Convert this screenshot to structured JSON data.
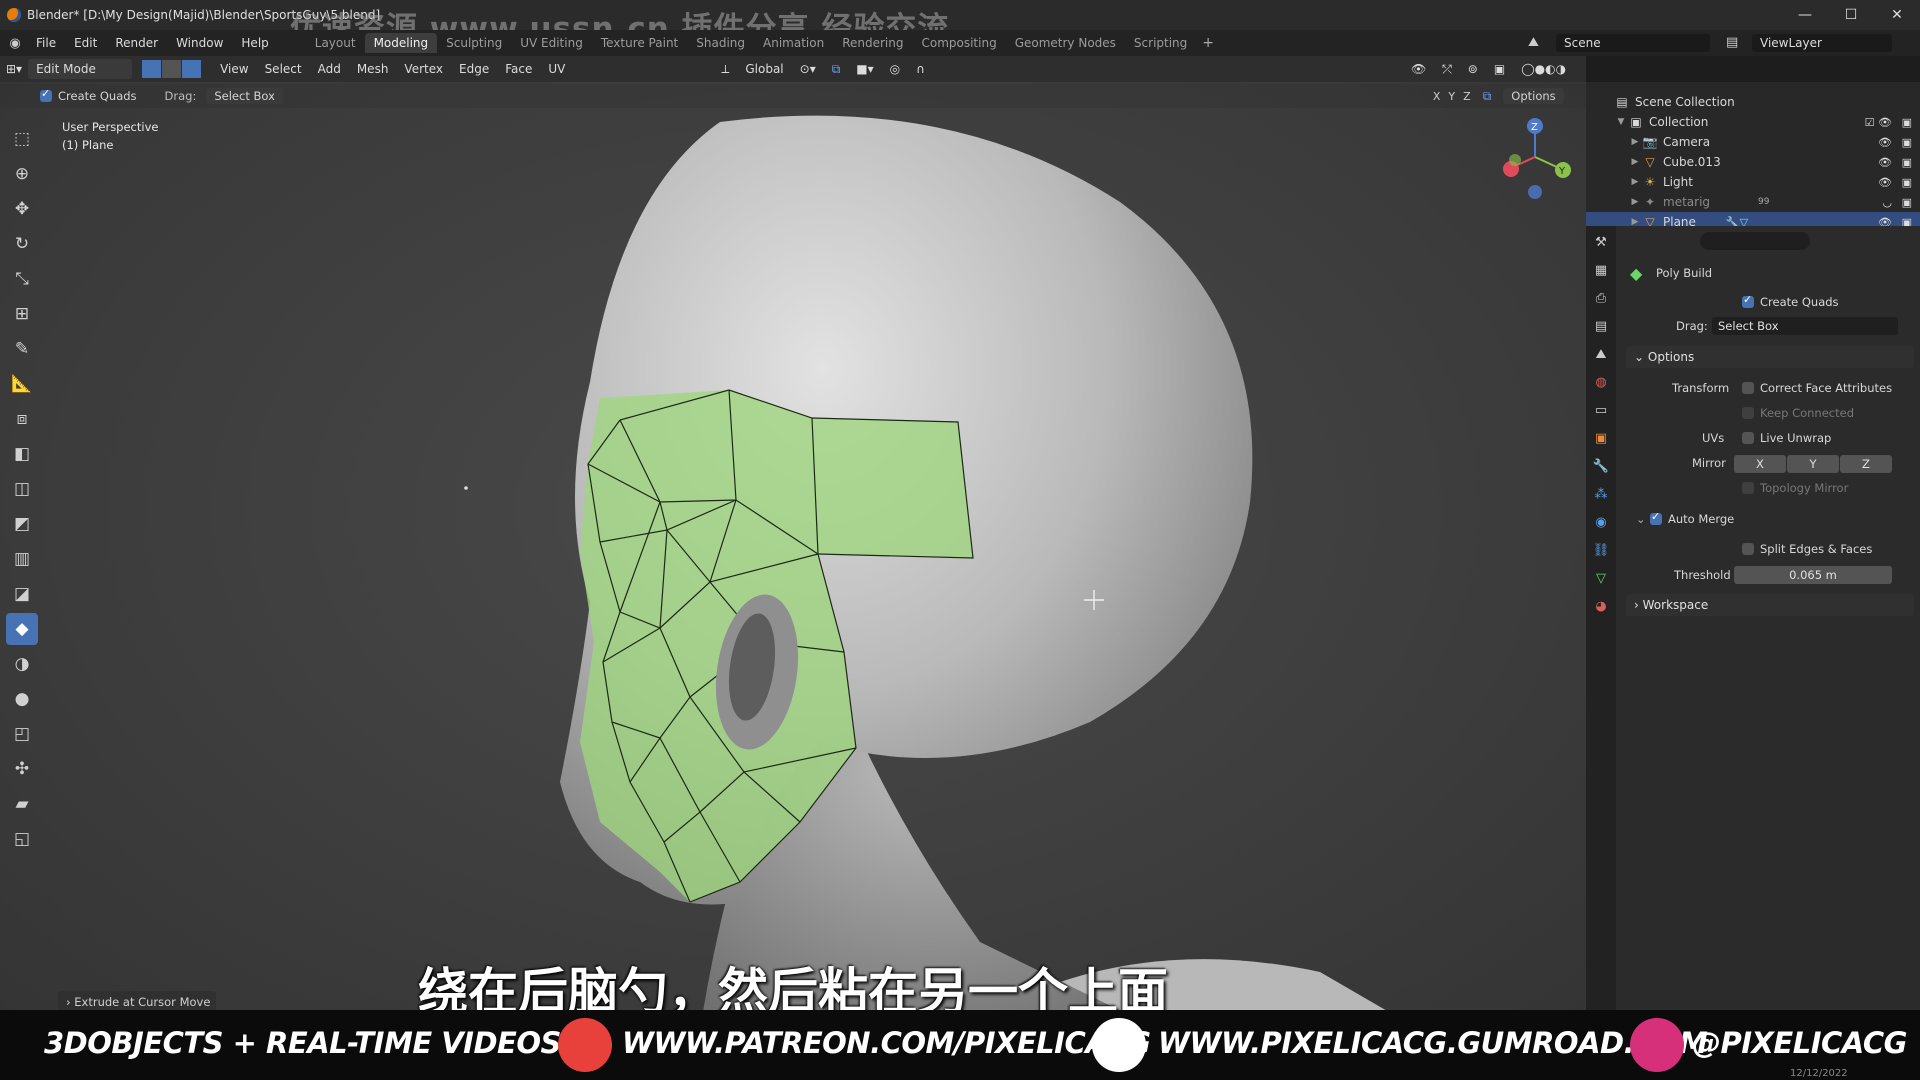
{
  "window": {
    "title": "Blender* [D:\\My Design(Majid)\\Blender\\SportsGuy\\5.blend]",
    "watermark": "优速资源 www.ussn.cn 插件分享 经验交流"
  },
  "menu": [
    "File",
    "Edit",
    "Render",
    "Window",
    "Help"
  ],
  "workspaces": [
    {
      "label": "Layout",
      "active": false
    },
    {
      "label": "Modeling",
      "active": true
    },
    {
      "label": "Sculpting",
      "active": false
    },
    {
      "label": "UV Editing",
      "active": false
    },
    {
      "label": "Texture Paint",
      "active": false
    },
    {
      "label": "Shading",
      "active": false
    },
    {
      "label": "Animation",
      "active": false
    },
    {
      "label": "Rendering",
      "active": false
    },
    {
      "label": "Compositing",
      "active": false
    },
    {
      "label": "Geometry Nodes",
      "active": false
    },
    {
      "label": "Scripting",
      "active": false
    }
  ],
  "scene": {
    "name": "Scene",
    "view_layer": "ViewLayer"
  },
  "header": {
    "mode": "Edit Mode",
    "menus": [
      "View",
      "Select",
      "Add",
      "Mesh",
      "Vertex",
      "Edge",
      "Face",
      "UV"
    ],
    "transform_orientation": "Global",
    "axes": [
      "X",
      "Y",
      "Z"
    ],
    "options_label": "Options"
  },
  "tool_settings": {
    "create_quads_label": "Create Quads",
    "drag_label": "Drag:",
    "drag_value": "Select Box"
  },
  "viewport": {
    "view_name": "User Perspective",
    "object_name": "(1) Plane",
    "gizmo": {
      "x": "X",
      "y": "Y",
      "z": "Z"
    }
  },
  "outliner": {
    "root": "Scene Collection",
    "collection": "Collection",
    "items": [
      {
        "name": "Camera",
        "icon": "camera-icon",
        "color": "#d18a4a"
      },
      {
        "name": "Cube.013",
        "icon": "mesh-icon",
        "color": "#e09e5a"
      },
      {
        "name": "Light",
        "icon": "light-icon",
        "color": "#e0b050"
      },
      {
        "name": "metarig",
        "icon": "armature-icon",
        "color": "#8a8a8a"
      },
      {
        "name": "Plane",
        "icon": "mesh-icon",
        "color": "#e09e5a"
      }
    ],
    "metarig_count": "99"
  },
  "properties": {
    "tool_name": "Poly Build",
    "create_quads": "Create Quads",
    "drag_label": "Drag:",
    "drag_value": "Select Box",
    "options_panel": "Options",
    "transform_label": "Transform",
    "correct_face_attributes": "Correct Face Attributes",
    "keep_connected": "Keep Connected",
    "uvs_label": "UVs",
    "live_unwrap": "Live Unwrap",
    "mirror_label": "Mirror",
    "mirror_axes": [
      "X",
      "Y",
      "Z"
    ],
    "topology_mirror": "Topology Mirror",
    "auto_merge": "Auto Merge",
    "split_edges_faces": "Split Edges & Faces",
    "threshold_label": "Threshold",
    "threshold_value": "0.065 m",
    "workspace_panel": "Workspace"
  },
  "last_operator": "Extrude at Cursor Move",
  "subtitle": "绕在后脑勺，然后粘在另一个上面",
  "banner": {
    "left": "3DOBJECTS + REAL-TIME VIDEOS",
    "patreon": "WWW.PATREON.COM/PIXELICACG",
    "gumroad": "WWW.PIXELICACG.GUMROAD.COM",
    "instagram": "@PIXELICACG"
  },
  "status_date": "12/12/2022",
  "colors": {
    "accent": "#4772b3",
    "selection": "#334d80",
    "mesh_green": "#9fd67f"
  }
}
